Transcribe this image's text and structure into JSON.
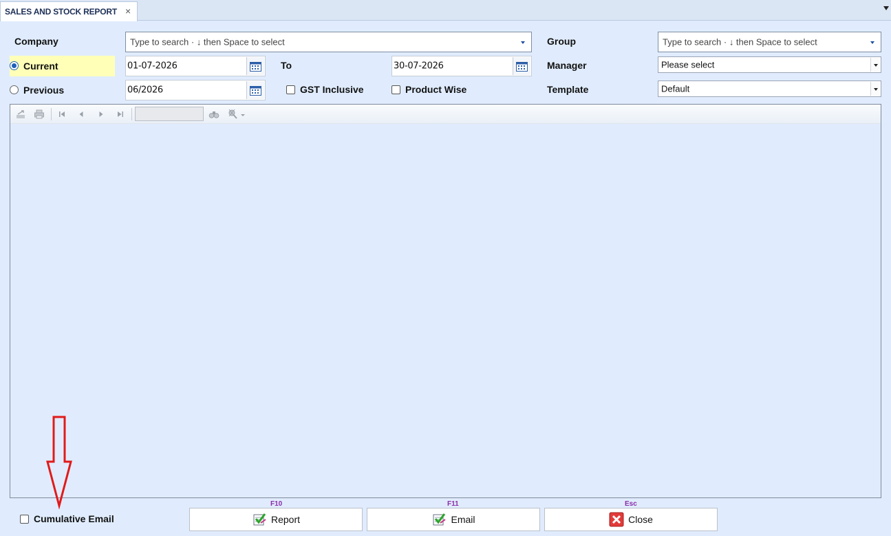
{
  "tab": {
    "title": "SALES AND STOCK REPORT",
    "close_glyph": "×"
  },
  "form": {
    "company_label": "Company",
    "company_placeholder": "Type to search · ↓ then Space to select",
    "group_label": "Group",
    "group_placeholder": "Type to search · ↓ then Space to select",
    "current_label": "Current",
    "current_selected": true,
    "from_date": "01-07-2026",
    "to_label": "To",
    "to_date": "30-07-2026",
    "manager_label": "Manager",
    "manager_value": "Please select",
    "previous_label": "Previous",
    "previous_selected": false,
    "previous_period": "06/2026",
    "gst_label": "GST Inclusive",
    "gst_checked": false,
    "product_wise_label": "Product Wise",
    "product_wise_checked": false,
    "template_label": "Template",
    "template_value": "Default"
  },
  "report_toolbar": {
    "icons": [
      "export-icon",
      "print-icon",
      "first-page-icon",
      "previous-page-icon",
      "next-page-icon",
      "last-page-icon",
      "find-icon",
      "zoom-icon"
    ],
    "page_box_value": ""
  },
  "footer": {
    "cumulative_label": "Cumulative Email",
    "cumulative_checked": false,
    "report": {
      "key": "F10",
      "label": "Report"
    },
    "email": {
      "key": "F11",
      "label": "Email"
    },
    "close": {
      "key": "Esc",
      "label": "Close"
    }
  },
  "colors": {
    "background": "#e0ecfd",
    "highlight": "#ffffb8",
    "shortcut_key": "#8a2ca8",
    "annotation_arrow": "#e01b1b"
  }
}
